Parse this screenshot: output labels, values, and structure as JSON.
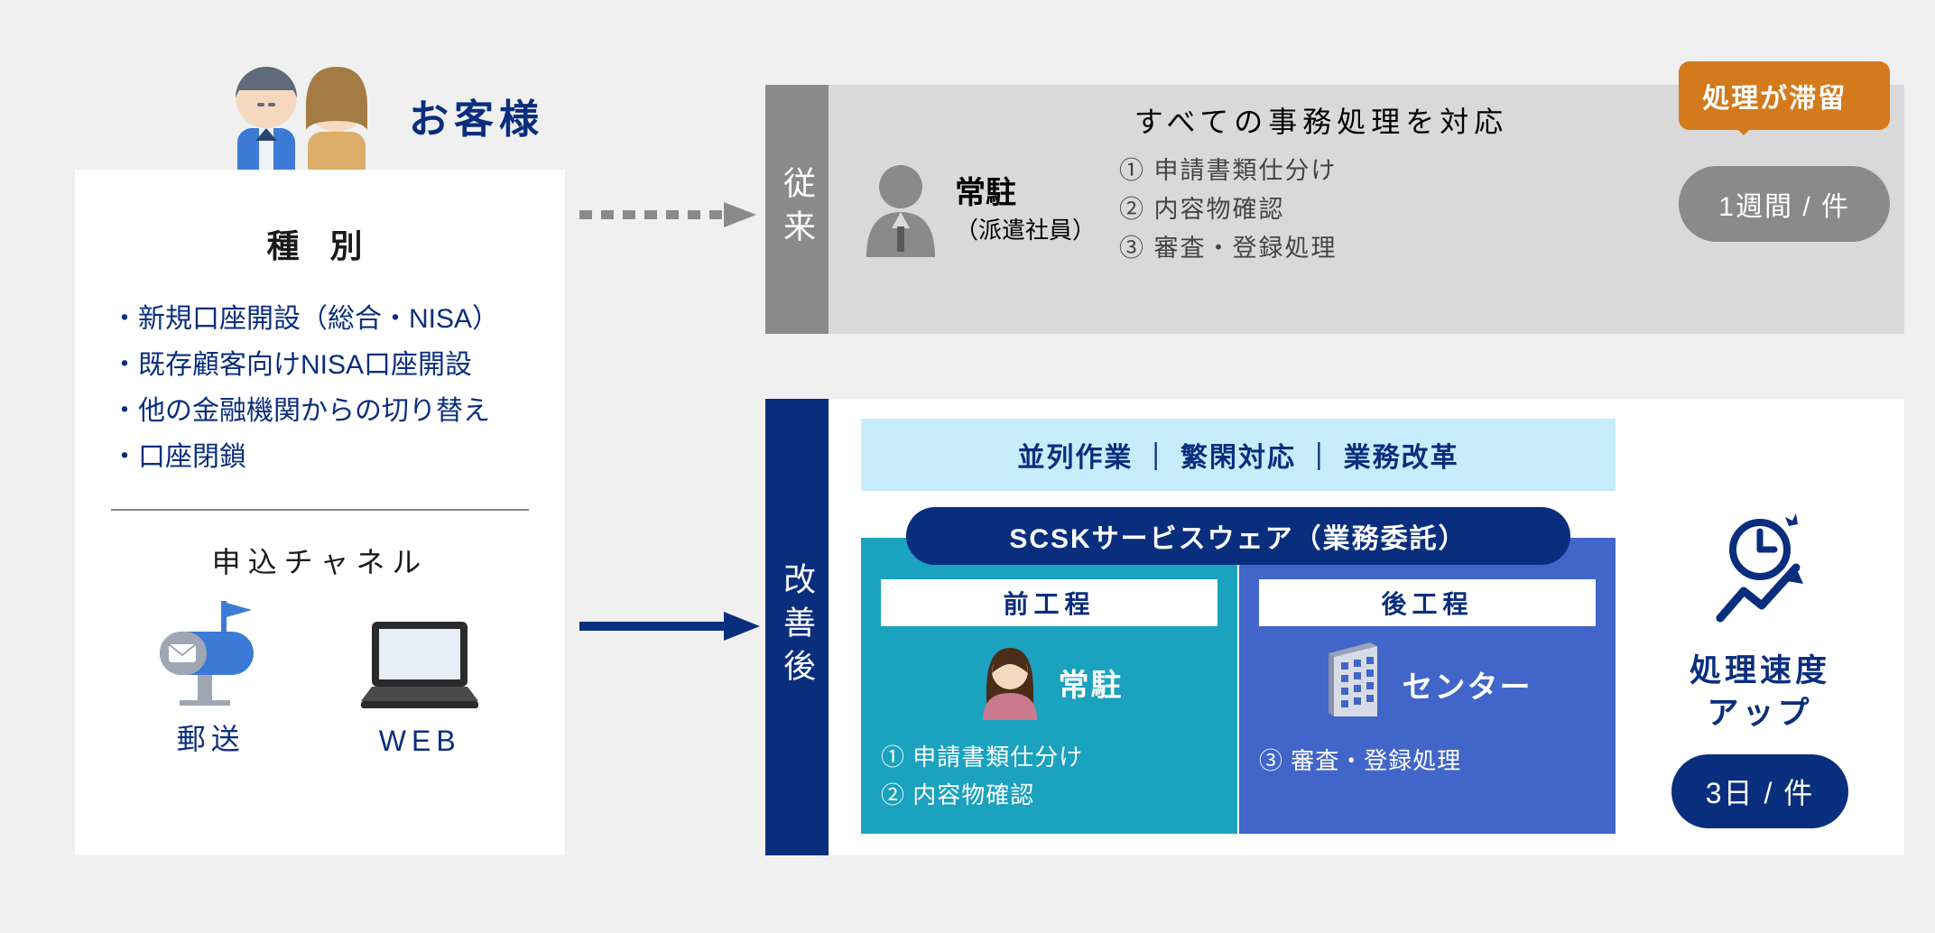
{
  "left": {
    "customer_label": "お客様",
    "type_title": "種 別",
    "types": [
      "新規口座開設（総合・NISA）",
      "既存顧客向けNISA口座開設",
      "他の金融機関からの切り替え",
      "口座閉鎖"
    ],
    "channel_title": "申込チャネル",
    "channel_mail": "郵送",
    "channel_web": "WEB"
  },
  "conventional": {
    "label": "従来",
    "header": "すべての事務処理を対応",
    "staff_title": "常駐",
    "staff_sub": "（派遣社員）",
    "tasks": [
      "① 申請書類仕分け",
      "② 内容物確認",
      "③ 審査・登録処理"
    ],
    "callout": "処理が滞留",
    "duration": "1週間 / 件"
  },
  "improved": {
    "label": "改善後",
    "strip": "並列作業 ｜ 繁閑対応 ｜ 業務改革",
    "scsk_title": "SCSKサービスウェア（業務委託）",
    "card1": {
      "head": "前工程",
      "mlabel": "常駐",
      "tasks": [
        "① 申請書類仕分け",
        "② 内容物確認"
      ]
    },
    "card2": {
      "head": "後工程",
      "mlabel": "センター",
      "tasks": [
        "③ 審査・登録処理"
      ]
    },
    "speed_line1": "処理速度",
    "speed_line2": "アップ",
    "duration": "3日 / 件"
  }
}
